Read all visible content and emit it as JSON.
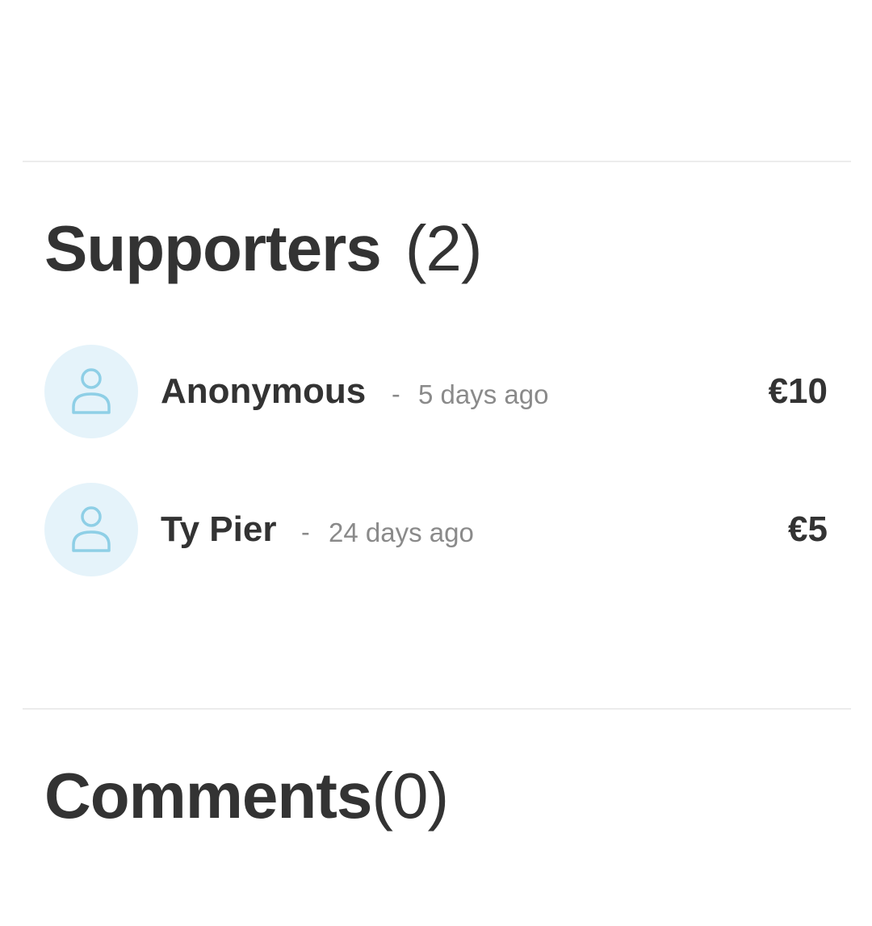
{
  "supporters": {
    "title": "Supporters",
    "count": "(2)",
    "items": [
      {
        "name": "Anonymous",
        "separator": "-",
        "time": "5 days ago",
        "amount": "€10",
        "avatar_icon": "user-icon"
      },
      {
        "name": "Ty Pier",
        "separator": "-",
        "time": "24 days ago",
        "amount": "€5",
        "avatar_icon": "user-icon"
      }
    ]
  },
  "comments": {
    "title": "Comments",
    "count": "(0)"
  },
  "colors": {
    "text": "#333333",
    "muted": "#8a8a8a",
    "avatar_bg": "#e5f3fa",
    "avatar_icon": "#8ecfe6",
    "divider": "#ececec"
  }
}
